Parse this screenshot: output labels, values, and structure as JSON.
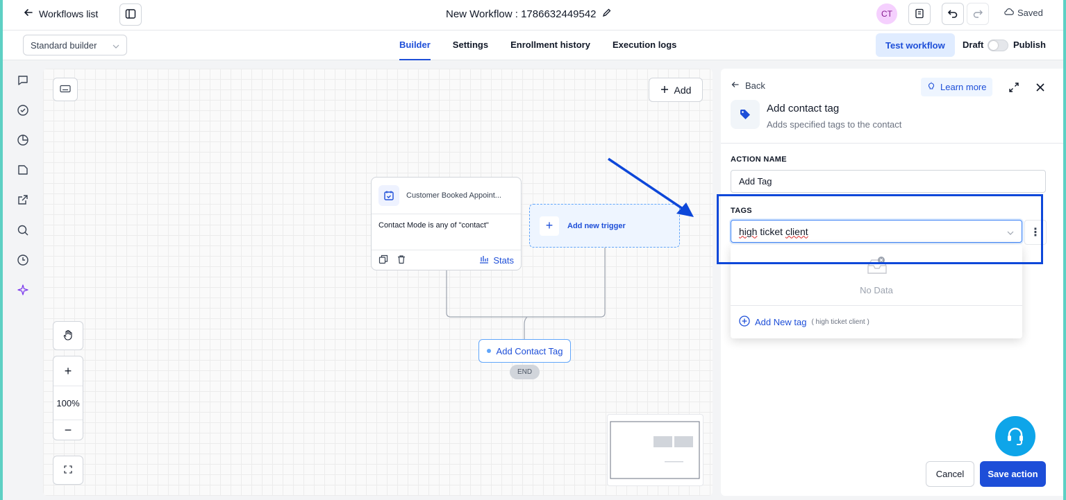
{
  "header": {
    "back_label": "Workflows list",
    "workflow_title": "New Workflow : 1786632449542",
    "avatar_initials": "CT",
    "saved_label": "Saved"
  },
  "subbar": {
    "builder_mode": "Standard builder",
    "tabs": [
      {
        "label": "Builder",
        "active": true
      },
      {
        "label": "Settings",
        "active": false
      },
      {
        "label": "Enrollment history",
        "active": false
      },
      {
        "label": "Execution logs",
        "active": false
      }
    ],
    "test_workflow_label": "Test workflow",
    "draft_label": "Draft",
    "publish_label": "Publish"
  },
  "sidebar": {
    "icons": [
      "chat-icon",
      "check-circle-icon",
      "pie-chart-icon",
      "file-icon",
      "external-link-icon",
      "search-icon",
      "history-icon",
      "sparkle-icon"
    ]
  },
  "canvas": {
    "add_label": "Add",
    "trigger_node": {
      "title": "Customer Booked Appoint...",
      "condition": "Contact Mode is any of \"contact\"",
      "stats_label": "Stats"
    },
    "add_trigger_label": "Add new trigger",
    "action_node_label": "Add Contact Tag",
    "end_label": "END",
    "zoom_level": "100%",
    "zoom_in_label": "+",
    "zoom_out_label": "−"
  },
  "panel": {
    "back_label": "Back",
    "learn_more_label": "Learn more",
    "title": "Add contact tag",
    "subtitle": "Adds specified tags to the contact",
    "action_name_label": "ACTION NAME",
    "action_name_value": "Add Tag",
    "tags_label": "TAGS",
    "tags_input_word1": "high",
    "tags_input_word2": "ticket",
    "tags_input_word3": "client",
    "no_data_label": "No Data",
    "add_new_tag_label": "Add New tag",
    "add_new_tag_hint": "( high ticket client )",
    "cancel_label": "Cancel",
    "save_label": "Save action"
  },
  "colors": {
    "accent": "#1d4ed8",
    "annotation": "#0d47d9",
    "support": "#0ea5e9"
  }
}
